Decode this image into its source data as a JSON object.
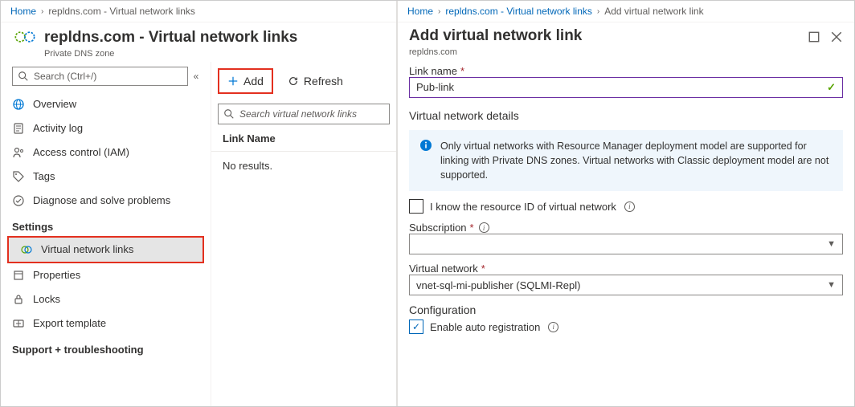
{
  "left": {
    "breadcrumb": {
      "home": "Home",
      "current": "repldns.com - Virtual network links"
    },
    "header": {
      "title": "repldns.com - Virtual network links",
      "subtitle": "Private DNS zone"
    },
    "search_placeholder": "Search (Ctrl+/)",
    "nav": {
      "items": [
        {
          "id": "overview",
          "label": "Overview",
          "icon": "globe"
        },
        {
          "id": "activity-log",
          "label": "Activity log",
          "icon": "log"
        },
        {
          "id": "access-control",
          "label": "Access control (IAM)",
          "icon": "iam"
        },
        {
          "id": "tags",
          "label": "Tags",
          "icon": "tag"
        },
        {
          "id": "diagnose",
          "label": "Diagnose and solve problems",
          "icon": "diagnose"
        }
      ],
      "settings_header": "Settings",
      "settings": [
        {
          "id": "vnet-links",
          "label": "Virtual network links",
          "icon": "vnet",
          "selected": true,
          "highlighted": true
        },
        {
          "id": "properties",
          "label": "Properties",
          "icon": "properties"
        },
        {
          "id": "locks",
          "label": "Locks",
          "icon": "lock"
        },
        {
          "id": "export-template",
          "label": "Export template",
          "icon": "export"
        }
      ],
      "support_header": "Support + troubleshooting"
    },
    "toolbar": {
      "add_label": "Add",
      "refresh_label": "Refresh"
    },
    "list": {
      "search_placeholder": "Search virtual network links",
      "header_link_name": "Link Name",
      "no_results": "No results."
    }
  },
  "right": {
    "breadcrumb": {
      "home": "Home",
      "mid": "repldns.com - Virtual network links",
      "current": "Add virtual network link"
    },
    "title": "Add virtual network link",
    "subtitle": "repldns.com",
    "link_name": {
      "label": "Link name",
      "value": "Pub-link"
    },
    "vnet_details_header": "Virtual network details",
    "info_text": "Only virtual networks with Resource Manager deployment model are supported for linking with Private DNS zones. Virtual networks with Classic deployment model are not supported.",
    "know_resource_id_label": "I know the resource ID of virtual network",
    "know_resource_id_checked": false,
    "subscription": {
      "label": "Subscription",
      "value": ""
    },
    "virtual_network": {
      "label": "Virtual network",
      "value": "vnet-sql-mi-publisher (SQLMI-Repl)"
    },
    "configuration_header": "Configuration",
    "auto_reg_label": "Enable auto registration",
    "auto_reg_checked": true
  }
}
